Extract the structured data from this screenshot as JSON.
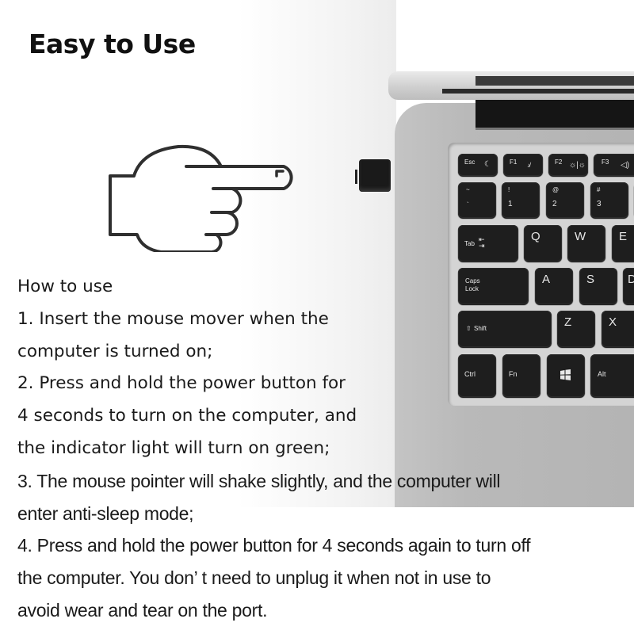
{
  "heading": "Easy to Use",
  "instructions": {
    "title": "How to use",
    "lines": [
      "1. Insert the mouse mover when the",
      "computer is turned on;",
      "2. Press and hold the power button for",
      "4 seconds to turn on the computer, and",
      "the indicator light will turn on green;",
      "3. The mouse pointer will shake slightly, and the computer will",
      "enter anti-sleep mode;",
      "4. Press and hold the power button for 4 seconds again to turn off",
      "the computer. You don’  t need to unplug it when not in use to",
      "avoid wear and tear on the port."
    ]
  },
  "illustration": {
    "pointer": "pointing-hand-icon",
    "device": "usb-mouse-mover-dongle",
    "laptop_keys": {
      "function_row": [
        {
          "label": "Esc",
          "icon": "sleep-icon"
        },
        {
          "label": "F1",
          "icon": "mute-mic-icon"
        },
        {
          "label": "F2",
          "icon": "brightness-icon"
        },
        {
          "label": "F3",
          "icon": "speaker-icon"
        }
      ],
      "number_row": [
        {
          "top": "~",
          "bottom": "`"
        },
        {
          "top": "!",
          "bottom": "1"
        },
        {
          "top": "@",
          "bottom": "2"
        },
        {
          "top": "#",
          "bottom": "3"
        }
      ],
      "tab_row": [
        "Tab",
        "Q",
        "W",
        "E"
      ],
      "caps_row": [
        "Caps Lock",
        "A",
        "S",
        "D"
      ],
      "shift_row": [
        "Shift",
        "Z",
        "X"
      ],
      "bottom_row": [
        "Ctrl",
        "Fn",
        "Win",
        "Alt"
      ]
    }
  }
}
